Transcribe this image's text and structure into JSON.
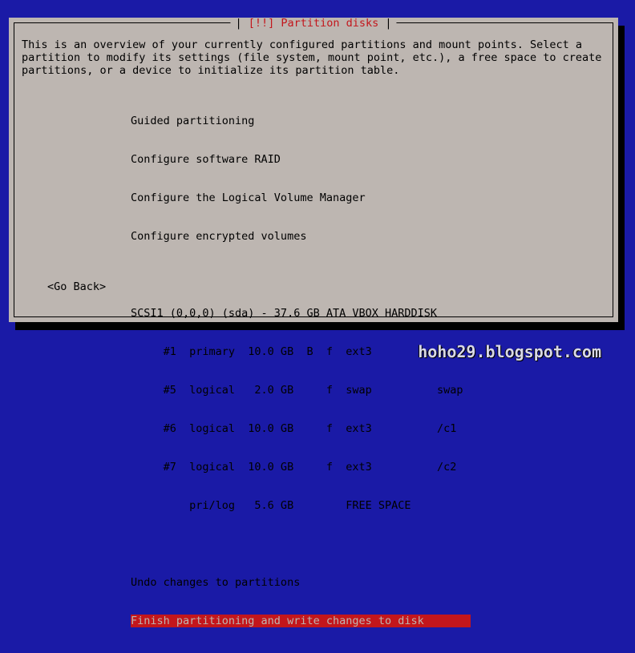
{
  "dialog": {
    "title": "[!!] Partition disks",
    "intro": [
      "This is an overview of your currently configured partitions and mount points. Select a",
      "partition to modify its settings (file system, mount point, etc.), a free space to create",
      "partitions, or a device to initialize its partition table."
    ]
  },
  "menu": {
    "guided": "Guided partitioning",
    "raid": "Configure software RAID",
    "lvm": "Configure the Logical Volume Manager",
    "encrypted": "Configure encrypted volumes",
    "disk": "SCSI1 (0,0,0) (sda) - 37.6 GB ATA VBOX HARDDISK",
    "partitions": [
      "     #1  primary  10.0 GB  B  f  ext3          /",
      "     #5  logical   2.0 GB     f  swap          swap",
      "     #6  logical  10.0 GB     f  ext3          /c1",
      "     #7  logical  10.0 GB     f  ext3          /c2",
      "         pri/log   5.6 GB        FREE SPACE"
    ],
    "undo": "Undo changes to partitions",
    "finish": "Finish partitioning and write changes to disk"
  },
  "go_back": "<Go Back>",
  "watermark": "hoho29.blogspot.com",
  "colors": {
    "background": "#1a1aa6",
    "dialog": "#bdb6b1",
    "highlight": "#c3161c"
  }
}
